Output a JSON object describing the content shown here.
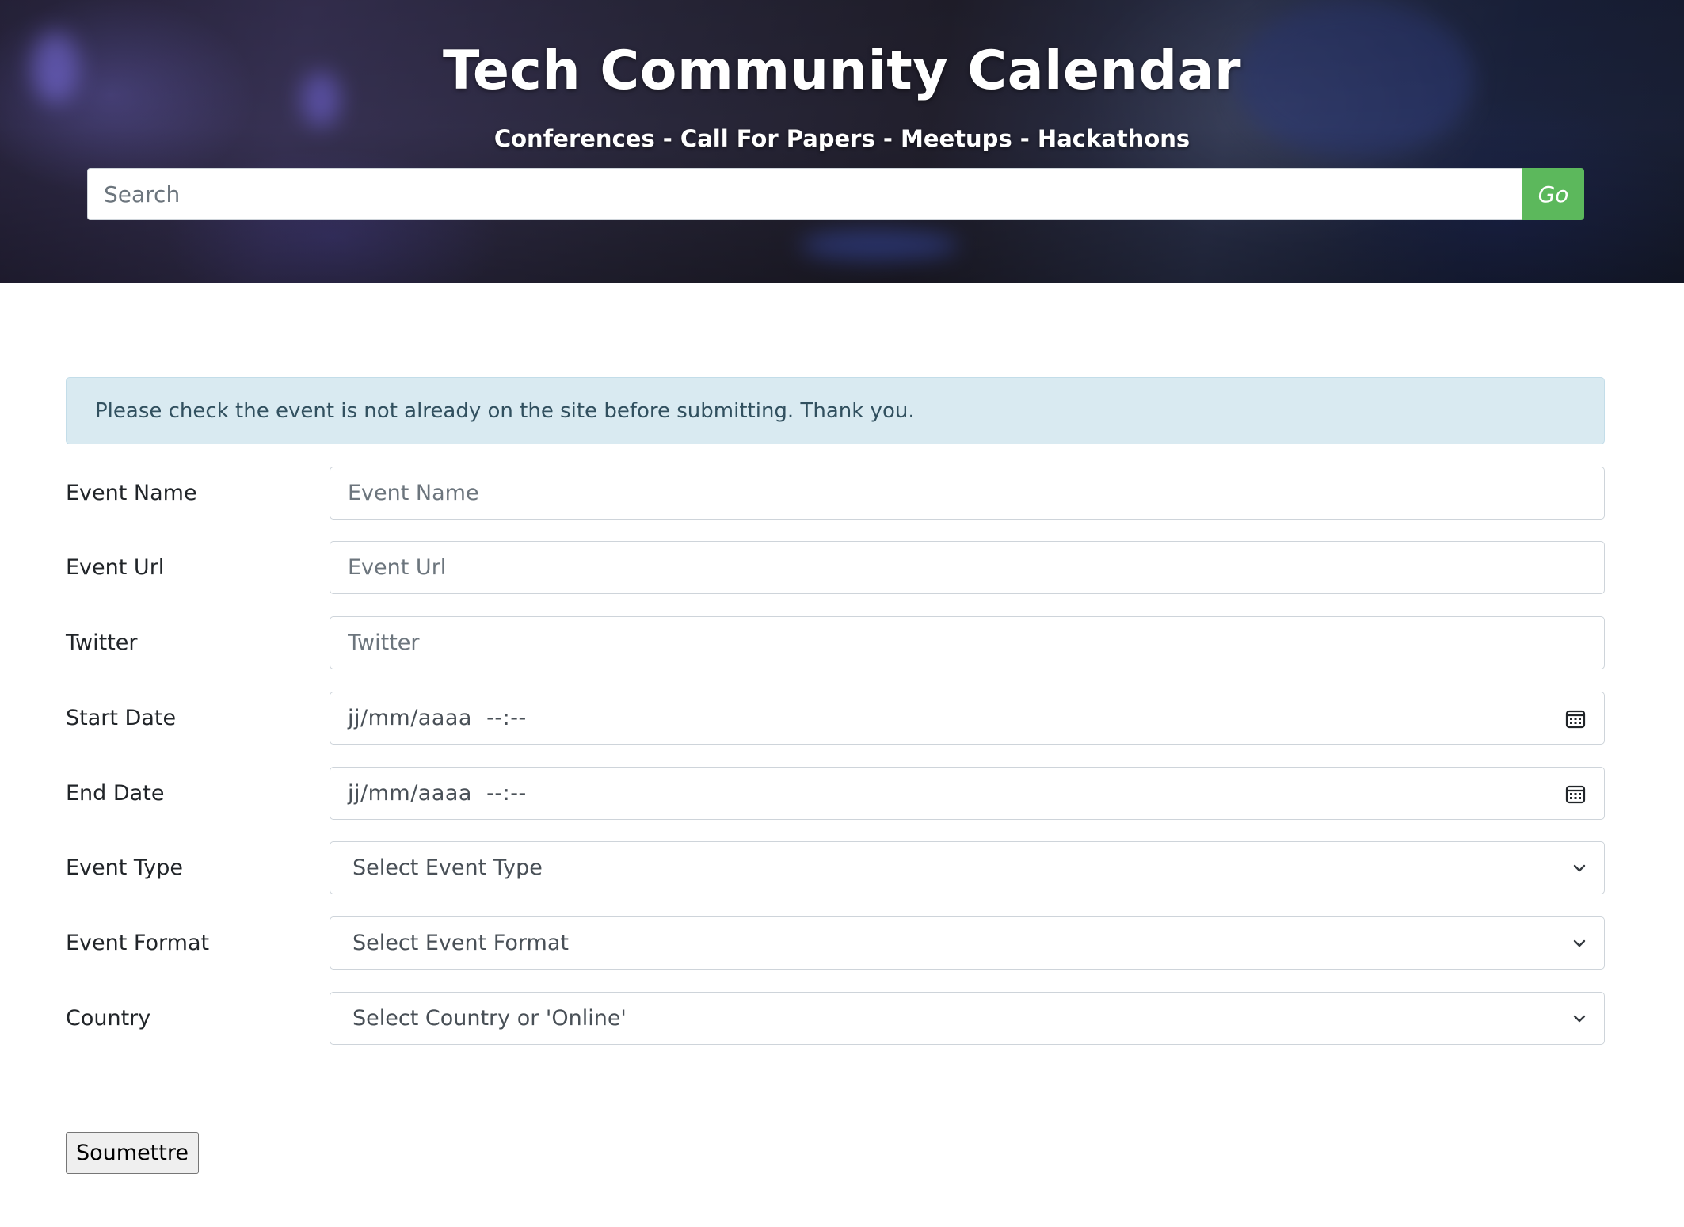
{
  "header": {
    "title": "Tech Community Calendar",
    "subtitle": "Conferences - Call For Papers - Meetups - Hackathons",
    "search": {
      "placeholder": "Search",
      "value": ""
    },
    "go_label": "Go"
  },
  "alert": {
    "text": "Please check the event is not already on the site before submitting. Thank you."
  },
  "form": {
    "event_name": {
      "label": "Event Name",
      "placeholder": "Event Name"
    },
    "event_url": {
      "label": "Event Url",
      "placeholder": "Event Url"
    },
    "twitter": {
      "label": "Twitter",
      "placeholder": "Twitter"
    },
    "start_date": {
      "label": "Start Date",
      "value": "jj/mm/aaaa  --:--",
      "icon": "calendar-icon"
    },
    "end_date": {
      "label": "End Date",
      "value": "jj/mm/aaaa  --:--",
      "icon": "calendar-icon"
    },
    "event_type": {
      "label": "Event Type",
      "selected": "Select Event Type",
      "icon": "chevron-down-icon"
    },
    "event_format": {
      "label": "Event Format",
      "selected": "Select Event Format",
      "icon": "chevron-down-icon"
    },
    "country": {
      "label": "Country",
      "selected": "Select Country or 'Online'",
      "icon": "chevron-down-icon"
    },
    "submit_label": "Soumettre"
  },
  "colors": {
    "go_button": "#5cb85c",
    "alert_background": "#d9eaf1",
    "alert_text": "#31505f"
  }
}
